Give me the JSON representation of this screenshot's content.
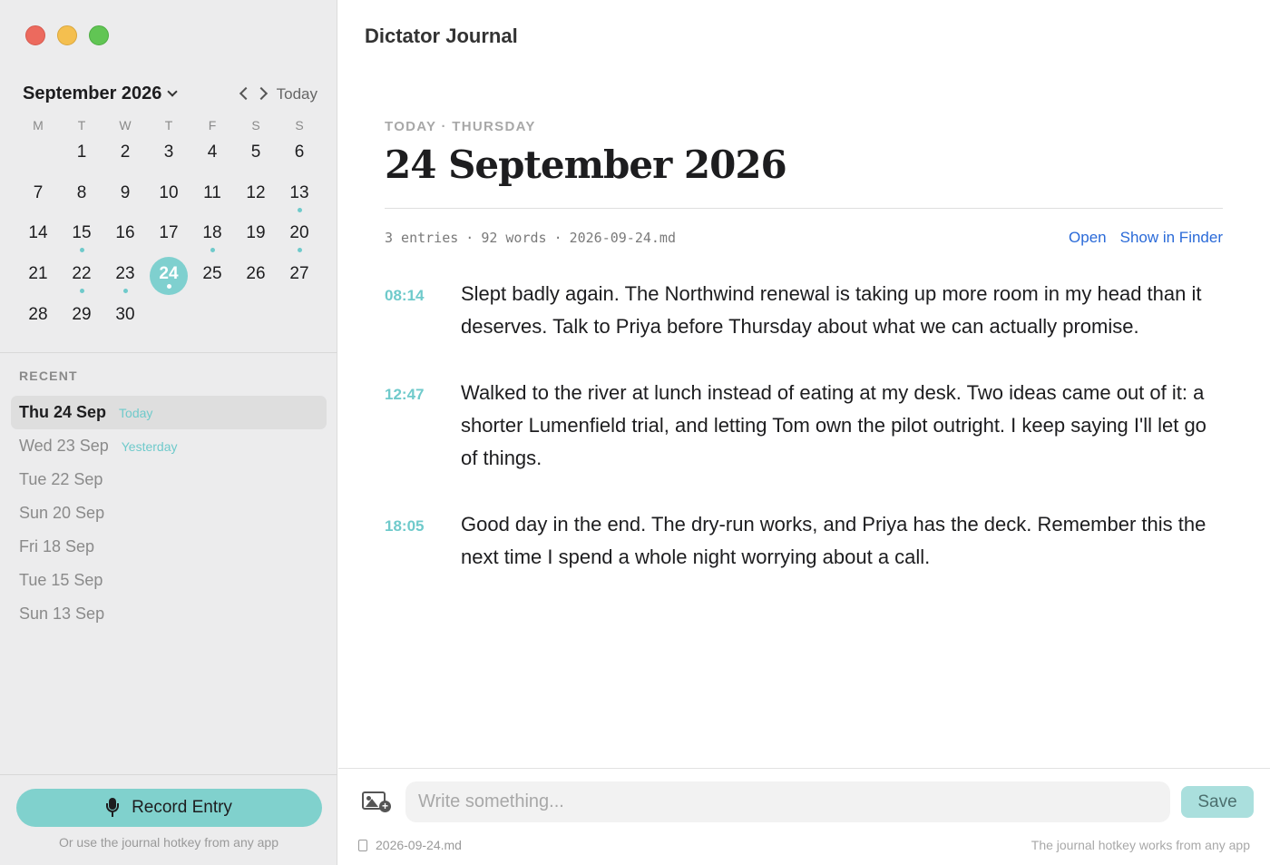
{
  "app": {
    "title": "Dictator Journal"
  },
  "calendar": {
    "month_label": "September 2026",
    "today_label": "Today",
    "weekdays": [
      "M",
      "T",
      "W",
      "T",
      "F",
      "S",
      "S"
    ],
    "leading_blanks": 1,
    "days": [
      {
        "n": "1",
        "dot": false
      },
      {
        "n": "2",
        "dot": false
      },
      {
        "n": "3",
        "dot": false
      },
      {
        "n": "4",
        "dot": false
      },
      {
        "n": "5",
        "dot": false
      },
      {
        "n": "6",
        "dot": false
      },
      {
        "n": "7",
        "dot": false
      },
      {
        "n": "8",
        "dot": false
      },
      {
        "n": "9",
        "dot": false
      },
      {
        "n": "10",
        "dot": false
      },
      {
        "n": "11",
        "dot": false
      },
      {
        "n": "12",
        "dot": false
      },
      {
        "n": "13",
        "dot": true
      },
      {
        "n": "14",
        "dot": false
      },
      {
        "n": "15",
        "dot": true
      },
      {
        "n": "16",
        "dot": false
      },
      {
        "n": "17",
        "dot": false
      },
      {
        "n": "18",
        "dot": true
      },
      {
        "n": "19",
        "dot": false
      },
      {
        "n": "20",
        "dot": true
      },
      {
        "n": "21",
        "dot": false
      },
      {
        "n": "22",
        "dot": true
      },
      {
        "n": "23",
        "dot": true
      },
      {
        "n": "24",
        "dot": true,
        "selected": true
      },
      {
        "n": "25",
        "dot": false
      },
      {
        "n": "26",
        "dot": false
      },
      {
        "n": "27",
        "dot": false
      },
      {
        "n": "28",
        "dot": false
      },
      {
        "n": "29",
        "dot": false
      },
      {
        "n": "30",
        "dot": false
      }
    ]
  },
  "recent": {
    "label": "RECENT",
    "items": [
      {
        "label": "Thu 24 Sep",
        "tag": "Today",
        "active": true
      },
      {
        "label": "Wed 23 Sep",
        "tag": "Yesterday",
        "active": false
      },
      {
        "label": "Tue 22 Sep",
        "tag": "",
        "active": false
      },
      {
        "label": "Sun 20 Sep",
        "tag": "",
        "active": false
      },
      {
        "label": "Fri 18 Sep",
        "tag": "",
        "active": false
      },
      {
        "label": "Tue 15 Sep",
        "tag": "",
        "active": false
      },
      {
        "label": "Sun 13 Sep",
        "tag": "",
        "active": false
      }
    ]
  },
  "record": {
    "button_label": "Record Entry",
    "note": "Or use the journal hotkey from any app"
  },
  "day": {
    "kicker": "TODAY · THURSDAY",
    "title": "24 September 2026",
    "entries_count": "3 entries",
    "words_count": "92 words",
    "filename": "2026-09-24.md",
    "meta_sep": "·",
    "open_label": "Open",
    "finder_label": "Show in Finder",
    "entries": [
      {
        "time": "08:14",
        "text": "Slept badly again. The Northwind renewal is taking up more room in my head than it deserves. Talk to Priya before Thursday about what we can actually promise."
      },
      {
        "time": "12:47",
        "text": "Walked to the river at lunch instead of eating at my desk. Two ideas came out of it: a shorter Lumenfield trial, and letting Tom own the pilot outright. I keep saying I'll let go of things."
      },
      {
        "time": "18:05",
        "text": "Good day in the end. The dry-run works, and Priya has the deck. Remember this the next time I spend a whole night worrying about a call."
      }
    ]
  },
  "composer": {
    "placeholder": "Write something...",
    "value": "",
    "save_label": "Save",
    "file_label": "2026-09-24.md",
    "hint": "The journal hotkey works from any app"
  },
  "colors": {
    "accent": "#7fd0cf",
    "link": "#2a6ad8",
    "sidebar_bg": "#ececed"
  },
  "icons": {
    "window_controls": [
      "close-icon",
      "minimize-icon",
      "zoom-icon"
    ],
    "month_dropdown": "chevron-down-icon",
    "prev": "chevron-left-icon",
    "next": "chevron-right-icon",
    "record": "microphone-icon",
    "attach": "image-add-icon",
    "file": "document-icon"
  }
}
